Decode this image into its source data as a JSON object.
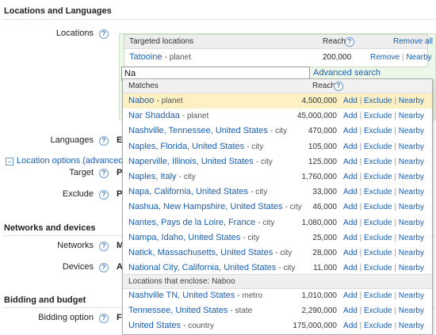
{
  "sections": {
    "locations_languages": "Locations and Languages",
    "networks_devices": "Networks and devices",
    "bidding_budget": "Bidding and budget"
  },
  "labels": {
    "locations": "Locations",
    "languages": "Languages",
    "location_options": "Location options (advanced)",
    "target": "Target",
    "exclude": "Exclude",
    "networks": "Networks",
    "devices": "Devices",
    "bidding_option": "Bidding option",
    "help_glyph": "?",
    "collapse_glyph": "−"
  },
  "truncated_values": {
    "languages": "E",
    "target": "P",
    "exclude": "P",
    "networks": "M",
    "devices": "A",
    "bidding_option": "F"
  },
  "targeted": {
    "header": "Targeted locations",
    "reach_header": "Reach",
    "remove_all": "Remove all",
    "row": {
      "name": "Tatooine",
      "type": "- planet",
      "reach": "200,000",
      "remove": "Remove",
      "sep": "|",
      "nearby": "Nearby"
    }
  },
  "search": {
    "value": "Na",
    "advanced_label": "Advanced search"
  },
  "dropdown": {
    "matches_header": "Matches",
    "reach_header": "Reach",
    "action_add": "Add",
    "action_exclude": "Exclude",
    "action_nearby": "Nearby",
    "sep": "|",
    "matches": [
      {
        "name": "Naboo",
        "type": "- planet",
        "reach": "4,500,000"
      },
      {
        "name": "Nar Shaddaa",
        "type": "- planet",
        "reach": "45,000,000"
      },
      {
        "name": "Nashville, Tennessee, United States",
        "type": "- city",
        "reach": "470,000"
      },
      {
        "name": "Naples, Florida, United States",
        "type": "- city",
        "reach": "105,000"
      },
      {
        "name": "Naperville, Illinois, United States",
        "type": "- city",
        "reach": "125,000"
      },
      {
        "name": "Naples, Italy",
        "type": "- city",
        "reach": "1,760,000"
      },
      {
        "name": "Napa, California, United States",
        "type": "- city",
        "reach": "33,000"
      },
      {
        "name": "Nashua, New Hampshire, United States",
        "type": "- city",
        "reach": "46,000"
      },
      {
        "name": "Nantes, Pays de la Loire, France",
        "type": "- city",
        "reach": "1,080,000"
      },
      {
        "name": "Nampa, Idaho, United States",
        "type": "- city",
        "reach": "25,000"
      },
      {
        "name": "Natick, Massachusetts, United States",
        "type": "- city",
        "reach": "28,000"
      },
      {
        "name": "National City, California, United States",
        "type": "- city",
        "reach": "11,000"
      }
    ],
    "enclose_header": "Locations that enclose: Naboo",
    "enclosing": [
      {
        "name": "Nashville TN, United States",
        "type": "- metro",
        "reach": "1,010,000"
      },
      {
        "name": "Tennessee, United States",
        "type": "- state",
        "reach": "2,290,000"
      },
      {
        "name": "United States",
        "type": "- country",
        "reach": "175,000,000"
      }
    ]
  }
}
